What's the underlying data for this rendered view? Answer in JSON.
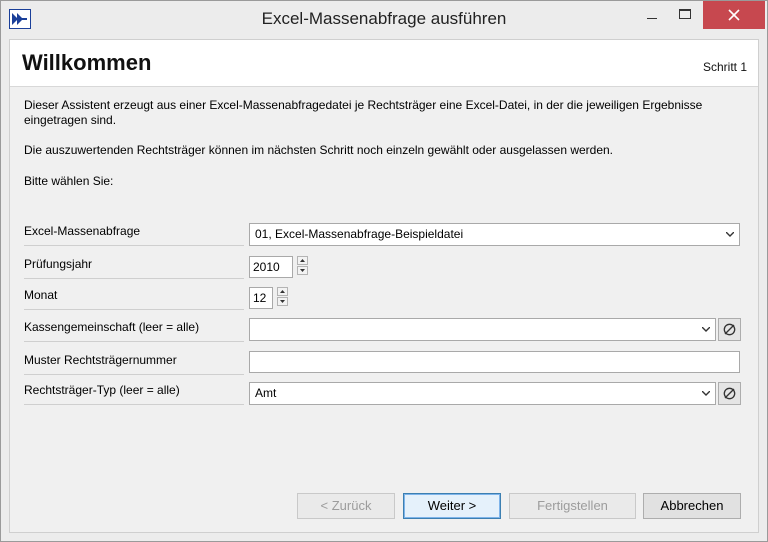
{
  "window": {
    "title": "Excel-Massenabfrage ausführen",
    "app_icon": "double-arrow-right-icon"
  },
  "header": {
    "title": "Willkommen",
    "step": "Schritt 1"
  },
  "intro": {
    "line1": "Dieser Assistent erzeugt aus einer Excel-Massenabfragedatei je Rechtsträger eine Excel-Datei, in der die jeweiligen Ergebnisse eingetragen sind.",
    "line2": "Die auszuwertenden Rechtsträger können im nächsten Schritt noch einzeln gewählt oder ausgelassen werden.",
    "line3": "Bitte wählen Sie:"
  },
  "form": {
    "massenabfrage": {
      "label": "Excel-Massenabfrage",
      "value": "01, Excel-Massenabfrage-Beispieldatei"
    },
    "pruefungsjahr": {
      "label": "Prüfungsjahr",
      "value": "2010"
    },
    "monat": {
      "label": "Monat",
      "value": "12"
    },
    "kassengemeinschaft": {
      "label": "Kassengemeinschaft (leer = alle)",
      "value": ""
    },
    "muster": {
      "label": "Muster Rechtsträgernummer",
      "value": ""
    },
    "typ": {
      "label": "Rechtsträger-Typ (leer = alle)",
      "value": "Amt"
    }
  },
  "buttons": {
    "back": "< Zurück",
    "next": "Weiter >",
    "finish": "Fertigstellen",
    "cancel": "Abbrechen"
  },
  "colors": {
    "close_button": "#c7484f",
    "app_icon_blue": "#1a3f99"
  }
}
